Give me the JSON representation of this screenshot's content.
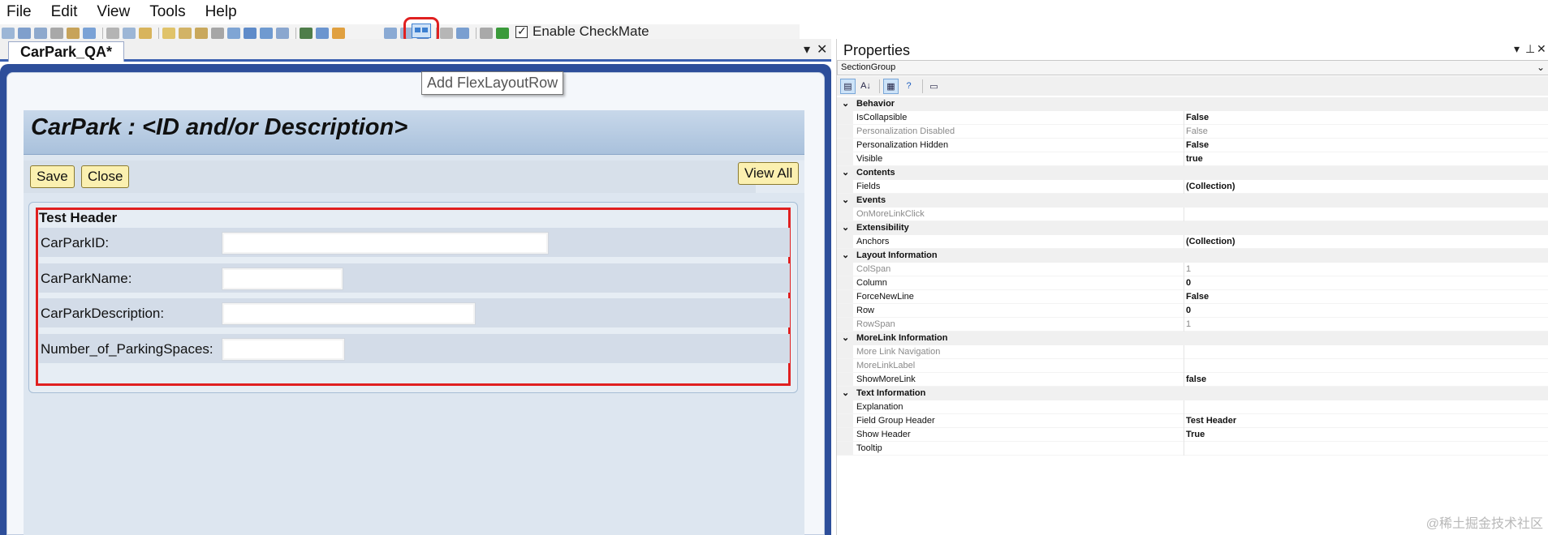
{
  "menu": [
    "File",
    "Edit",
    "View",
    "Tools",
    "Help"
  ],
  "toolbar": {
    "enable_label": "Enable CheckMate"
  },
  "tooltip": "Add FlexLayoutRow",
  "doc_tab": {
    "label": "CarPark_QA*",
    "pin_glyph": "▾",
    "close_glyph": "✕"
  },
  "page": {
    "title": "CarPark : <ID and/or Description>",
    "buttons": {
      "save": "Save",
      "close": "Close",
      "view_all": "View All"
    },
    "section": {
      "header": "Test Header",
      "fields": [
        {
          "label": "CarParkID:"
        },
        {
          "label": "CarParkName:"
        },
        {
          "label": "CarParkDescription:"
        },
        {
          "label": "Number_of_ParkingSpaces:"
        }
      ]
    }
  },
  "properties": {
    "title": "Properties",
    "controls": {
      "dropdown": "▾",
      "pin": "⊥",
      "close": "✕"
    },
    "selected_object": "SectionGroup",
    "tools": {
      "categorized_icon": "categorized-icon",
      "alphabetical_icon": "alphabetical-icon",
      "properties_icon": "properties-icon",
      "help_icon": "help-icon",
      "pages_icon": "property-pages-icon"
    },
    "categories": [
      {
        "name": "Behavior",
        "props": [
          {
            "name": "IsCollapsible",
            "value": "False",
            "dim": false
          },
          {
            "name": "Personalization Disabled",
            "value": "False",
            "dim": true
          },
          {
            "name": "Personalization Hidden",
            "value": "False",
            "dim": false
          },
          {
            "name": "Visible",
            "value": "true",
            "dim": false
          }
        ]
      },
      {
        "name": "Contents",
        "props": [
          {
            "name": "Fields",
            "value": "(Collection)",
            "dim": false
          }
        ]
      },
      {
        "name": "Events",
        "props": [
          {
            "name": "OnMoreLinkClick",
            "value": "",
            "dim": true
          }
        ]
      },
      {
        "name": "Extensibility",
        "props": [
          {
            "name": "Anchors",
            "value": "(Collection)",
            "dim": false
          }
        ]
      },
      {
        "name": "Layout Information",
        "props": [
          {
            "name": "ColSpan",
            "value": "1",
            "dim": true
          },
          {
            "name": "Column",
            "value": "0",
            "dim": false
          },
          {
            "name": "ForceNewLine",
            "value": "False",
            "dim": false
          },
          {
            "name": "Row",
            "value": "0",
            "dim": false
          },
          {
            "name": "RowSpan",
            "value": "1",
            "dim": true
          }
        ]
      },
      {
        "name": "MoreLink Information",
        "props": [
          {
            "name": "More Link Navigation",
            "value": "",
            "dim": true
          },
          {
            "name": "MoreLinkLabel",
            "value": "",
            "dim": true
          },
          {
            "name": "ShowMoreLink",
            "value": "false",
            "dim": false
          }
        ]
      },
      {
        "name": "Text Information",
        "props": [
          {
            "name": "Explanation",
            "value": "",
            "dim": false
          },
          {
            "name": "Field Group Header",
            "value": "Test Header",
            "dim": false
          },
          {
            "name": "Show Header",
            "value": "True",
            "dim": false
          },
          {
            "name": "Tooltip",
            "value": "",
            "dim": false
          }
        ]
      }
    ]
  },
  "watermark": "@稀土掘金技术社区"
}
